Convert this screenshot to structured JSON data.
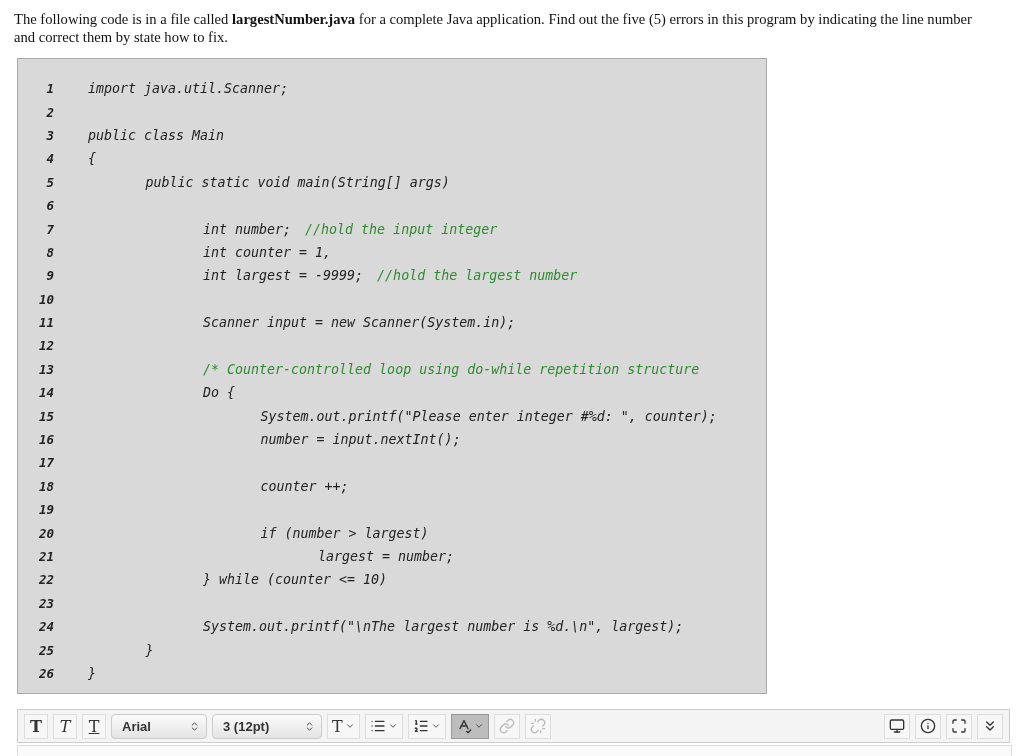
{
  "question": "The following code is in a file called **largestNumber.java** for a complete Java application. Find out the five (5) errors in this program by indicating the line number and correct them by state how to fix.",
  "code_lines": [
    {
      "number": "1",
      "code": "import java.util.Scanner;"
    },
    {
      "number": "2"
    },
    {
      "number": "3",
      "code": "public class Main"
    },
    {
      "number": "4",
      "code": "{",
      "children": [
        {
          "number": "5",
          "code": "public static void main(String[] args)",
          "children": [
            {
              "number": "6"
            },
            {
              "number": "7",
              "code": "int number;",
              "comment": "//hold the input integer"
            },
            {
              "number": "8",
              "code": "int counter = 1,"
            },
            {
              "number": "9",
              "code": "int largest = -9999;",
              "comment": "//hold the largest number"
            },
            {
              "number": "10"
            },
            {
              "number": "11",
              "code": "Scanner input = new Scanner(System.in);"
            },
            {
              "number": "12"
            },
            {
              "number": "13",
              "comment": "/* Counter-controlled loop using do-while repetition structure"
            },
            {
              "number": "14",
              "code": "Do {",
              "children": [
                {
                  "number": "15",
                  "code": "System.out.printf(\"Please enter integer #%d: \", counter);"
                },
                {
                  "number": "16",
                  "code": "number = input.nextInt();"
                },
                {
                  "number": "17"
                },
                {
                  "number": "18",
                  "code": "counter ++;"
                },
                {
                  "number": "19"
                },
                {
                  "number": "20",
                  "code": "if (number > largest)",
                  "children": [
                    {
                      "number": "21",
                      "code": "largest = number;"
                    }
                  ]
                }
              ]
            },
            {
              "number": "22",
              "code": "} while (counter <= 10)"
            },
            {
              "number": "23"
            },
            {
              "number": "24",
              "code": "System.out.printf(\"\\nThe largest number is %d.\\n\", largest);"
            }
          ]
        },
        {
          "number": "25",
          "code": "}"
        }
      ]
    },
    {
      "number": "26",
      "code": "}"
    }
  ],
  "toolbar": {
    "left": [
      {
        "kind": "bold",
        "label": "T"
      },
      {
        "kind": "italic",
        "label": "T"
      },
      {
        "kind": "underline",
        "label": "T"
      },
      {
        "kind": "select",
        "value": "Arial"
      },
      {
        "kind": "select",
        "value": "3 (12pt)"
      },
      {
        "kind": "textcolor",
        "label": "T"
      },
      {
        "kind": "bullets"
      },
      {
        "kind": "numbering"
      },
      {
        "kind": "spellcheck",
        "pressed": true
      },
      {
        "kind": "link",
        "disabled": true
      },
      {
        "kind": "unlink",
        "disabled": true
      }
    ],
    "right": [
      {
        "kind": "preview"
      },
      {
        "kind": "info"
      },
      {
        "kind": "fullscreen"
      },
      {
        "kind": "more"
      }
    ]
  }
}
